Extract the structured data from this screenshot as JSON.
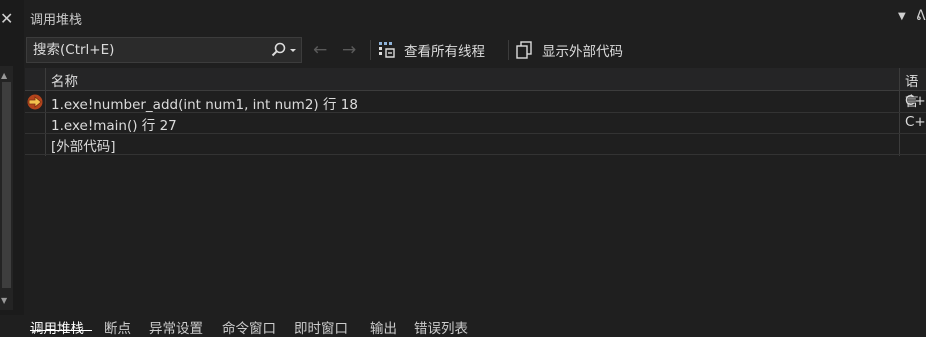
{
  "panel": {
    "title": "调用堆栈"
  },
  "search": {
    "placeholder": "搜索(Ctrl+E)"
  },
  "toolbar": {
    "view_all_threads": "查看所有线程",
    "show_external_code": "显示外部代码"
  },
  "grid": {
    "columns": {
      "name": "名称",
      "language": "语言"
    },
    "rows": [
      {
        "name": "1.exe!number_add(int num1, int num2) 行 18",
        "language": "C++",
        "current": true
      },
      {
        "name": "1.exe!main() 行 27",
        "language": "C++",
        "current": false
      },
      {
        "name": "[外部代码]",
        "language": "",
        "current": false
      }
    ]
  },
  "bottom_tabs": [
    "调用堆栈",
    "断点",
    "异常设置",
    "命令窗口",
    "即时窗口",
    "输出",
    "错误列表"
  ],
  "colors": {
    "background": "#1f1f1f",
    "current_frame_arrow": "#e8a23a"
  },
  "icons": {
    "search": "search-icon",
    "back": "arrow-left-icon",
    "forward": "arrow-right-icon",
    "threads": "threads-icon",
    "external": "external-code-icon",
    "current": "current-frame-arrow-icon"
  }
}
